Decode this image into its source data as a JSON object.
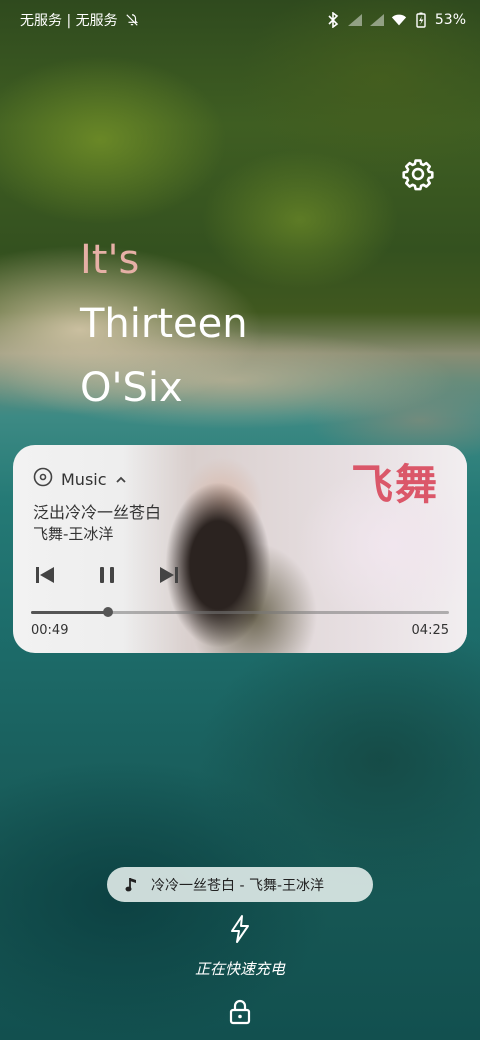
{
  "status_bar": {
    "carrier_text": "无服务 | 无服务",
    "battery_percent": "53%",
    "icons": [
      "bell-off-icon",
      "bluetooth-icon",
      "signal-icon",
      "signal-icon",
      "wifi-icon",
      "battery-charging-icon"
    ]
  },
  "clock": {
    "line1": "It's",
    "line2": "Thirteen",
    "line3": "O'Six"
  },
  "settings": {
    "icon": "gear-icon"
  },
  "media": {
    "app_label": "Music",
    "song_title": "泛出冷冷一丝苍白",
    "song_artist": "飞舞-王冰洋",
    "album_art_text": "飞舞",
    "elapsed": "00:49",
    "total": "04:25",
    "progress_fraction": 0.185,
    "controls": [
      "previous-icon",
      "pause-icon",
      "next-icon"
    ]
  },
  "now_playing": {
    "text": "冷冷一丝苍白 - 飞舞-王冰洋"
  },
  "charging": {
    "text": "正在快速充电"
  },
  "colors": {
    "clock_accent": "#e6b0a6",
    "album_title_red": "#d9485b"
  }
}
